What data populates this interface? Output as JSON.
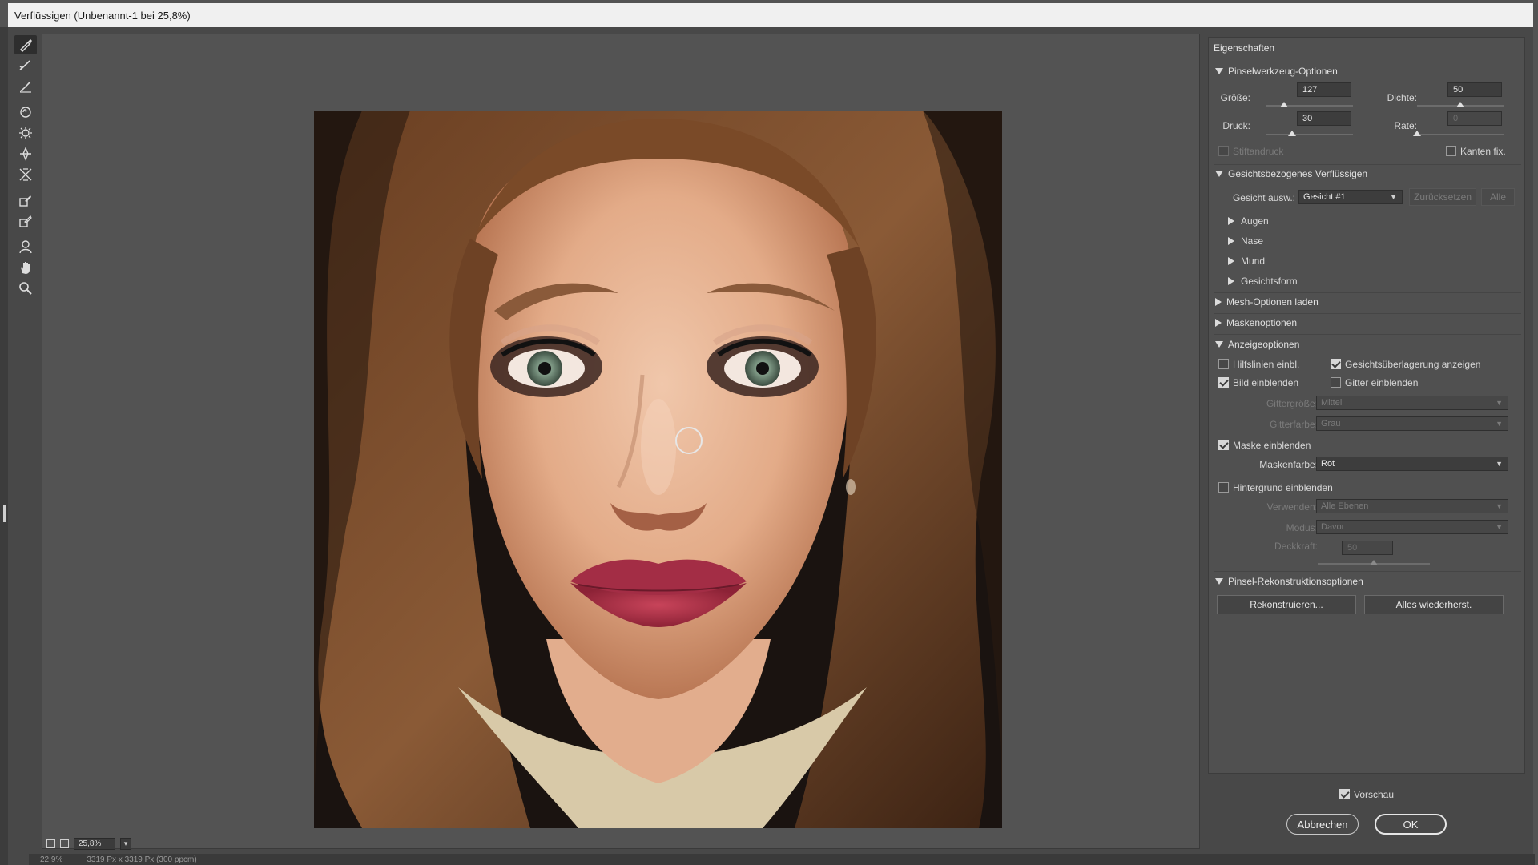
{
  "window": {
    "title": "Verflüssigen (Unbenannt-1 bei 25,8%)"
  },
  "toolbar": {
    "tools": [
      {
        "name": "forward-warp-tool-icon"
      },
      {
        "name": "reconstruct-tool-icon"
      },
      {
        "name": "smooth-tool-icon"
      },
      {
        "name": "twirl-tool-icon"
      },
      {
        "name": "pucker-tool-icon"
      },
      {
        "name": "bloat-tool-icon"
      },
      {
        "name": "push-left-tool-icon"
      },
      {
        "name": "freeze-mask-tool-icon"
      },
      {
        "name": "thaw-mask-tool-icon"
      },
      {
        "name": "face-tool-icon"
      },
      {
        "name": "hand-tool-icon"
      },
      {
        "name": "zoom-tool-icon"
      }
    ]
  },
  "canvas": {
    "zoom": "25,8%"
  },
  "status": {
    "zoom": "22,9%",
    "size": "3319 Px x 3319 Px (300 ppcm)"
  },
  "panel": {
    "title": "Eigenschaften",
    "brush": {
      "header": "Pinselwerkzeug-Optionen",
      "size_label": "Größe:",
      "size_value": "127",
      "size_fraction": 0.2,
      "density_label": "Dichte:",
      "density_value": "50",
      "density_fraction": 0.5,
      "pressure_label": "Druck:",
      "pressure_value": "30",
      "pressure_fraction": 0.3,
      "rate_label": "Rate:",
      "rate_value": "0",
      "rate_fraction": 0.0,
      "stylus_label": "Stiftandruck",
      "stylus_checked": false,
      "pin_edges_label": "Kanten fix.",
      "pin_edges_checked": false
    },
    "face": {
      "header": "Gesichtsbezogenes Verflüssigen",
      "select_label": "Gesicht ausw.:",
      "select_value": "Gesicht #1",
      "reset_label": "Zurücksetzen",
      "all_label": "Alle",
      "subsections": [
        "Augen",
        "Nase",
        "Mund",
        "Gesichtsform"
      ]
    },
    "mesh": {
      "header": "Mesh-Optionen laden"
    },
    "mask": {
      "header": "Maskenoptionen"
    },
    "view": {
      "header": "Anzeigeoptionen",
      "guides_label": "Hilfslinien einbl.",
      "guides_checked": false,
      "face_overlay_label": "Gesichtsüberlagerung anzeigen",
      "face_overlay_checked": true,
      "show_image_label": "Bild einblenden",
      "show_image_checked": true,
      "show_mesh_label": "Gitter einblenden",
      "show_mesh_checked": false,
      "mesh_size_label": "Gittergröße:",
      "mesh_size_value": "Mittel",
      "mesh_color_label": "Gitterfarbe:",
      "mesh_color_value": "Grau",
      "show_mask_label": "Maske einblenden",
      "show_mask_checked": true,
      "mask_color_label": "Maskenfarbe:",
      "mask_color_value": "Rot",
      "show_backdrop_label": "Hintergrund einblenden",
      "show_backdrop_checked": false,
      "use_label": "Verwenden:",
      "use_value": "Alle Ebenen",
      "mode_label": "Modus:",
      "mode_value": "Davor",
      "opacity_label": "Deckkraft:",
      "opacity_value": "50",
      "opacity_fraction": 0.5
    },
    "reconstruct": {
      "header": "Pinsel-Rekonstruktionsoptionen",
      "reconstruct_button": "Rekonstruieren...",
      "restore_all_button": "Alles wiederherst."
    }
  },
  "footer": {
    "preview_label": "Vorschau",
    "preview_checked": true,
    "cancel_label": "Abbrechen",
    "ok_label": "OK"
  },
  "colors": {
    "accent": "#e6e6e6",
    "panel": "#505050",
    "background": "#535353"
  }
}
